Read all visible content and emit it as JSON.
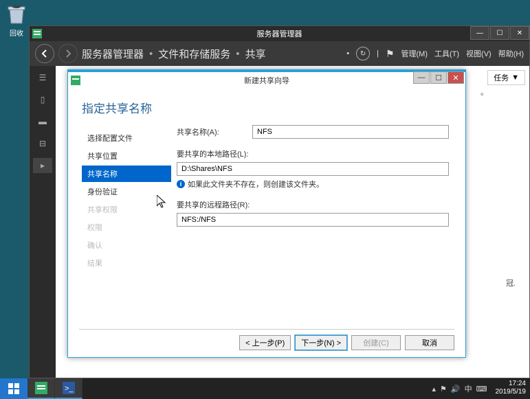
{
  "desktop": {
    "recycle_bin": "回收"
  },
  "server_manager": {
    "title": "服务器管理器",
    "breadcrumb": {
      "root": "服务器管理器",
      "section": "文件和存储服务",
      "page": "共享"
    },
    "menu": {
      "manage": "管理(M)",
      "tools": "工具(T)",
      "view": "视图(V)",
      "help": "帮助(H)"
    },
    "tasks_button": "任务",
    "right_panel_1": "。",
    "right_panel_2": "冠."
  },
  "wizard": {
    "title": "新建共享向导",
    "heading": "指定共享名称",
    "steps": {
      "select_profile": "选择配置文件",
      "share_location": "共享位置",
      "share_name": "共享名称",
      "authentication": "身份验证",
      "share_permissions": "共享权限",
      "permissions": "权限",
      "confirmation": "确认",
      "results": "结果"
    },
    "form": {
      "share_name_label": "共享名称(A):",
      "share_name_value": "NFS",
      "local_path_label": "要共享的本地路径(L):",
      "local_path_value": "D:\\Shares\\NFS",
      "info_text": "如果此文件夹不存在，则创建该文件夹。",
      "remote_path_label": "要共享的远程路径(R):",
      "remote_path_value": "NFS:/NFS"
    },
    "buttons": {
      "previous": "< 上一步(P)",
      "next": "下一步(N) >",
      "create": "创建(C)",
      "cancel": "取消"
    }
  },
  "taskbar": {
    "time": "17:24",
    "date": "2019/5/19"
  }
}
